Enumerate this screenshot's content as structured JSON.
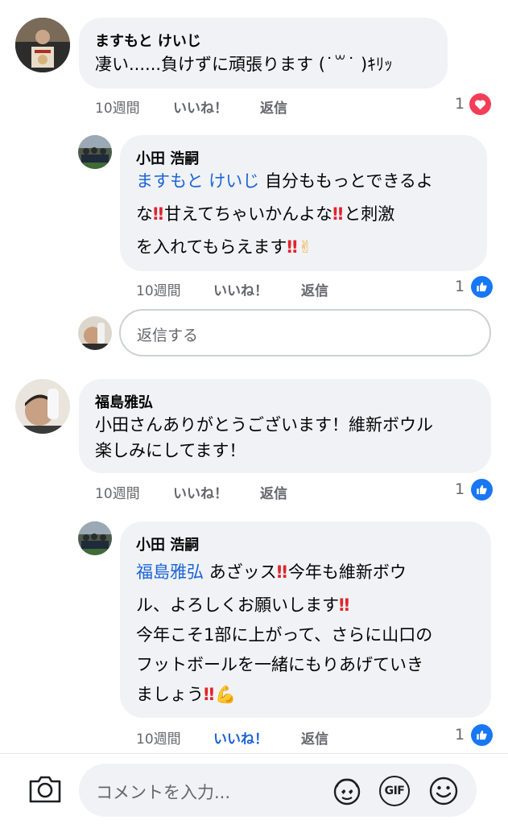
{
  "comments": [
    {
      "author": "ますもと けいじ",
      "lines": [
        "凄い......負けずに頑張ります (˙꒳˙ )ｷﾘｯ"
      ],
      "time": "10週間",
      "like": "いいね！",
      "reply": "返信",
      "reaction_count": "1",
      "reaction_icon": "heart-icon"
    },
    {
      "author": "小田 浩嗣",
      "mention": "ますもと けいじ",
      "line1_text": "自分ももっとできるよ",
      "line2_a": "な",
      "line2_b": "甘えてちゃいかんよな",
      "line2_c": "と刺激",
      "line3": "を入れてもらえます",
      "time": "10週間",
      "like": "いいね！",
      "reply": "返信",
      "reaction_count": "1",
      "reaction_icon": "thumbs-up-icon",
      "emoji_bang": "‼",
      "emoji_v": "✌"
    },
    {
      "author": "福島雅弘",
      "lines": [
        "小田さんありがとうございます！維新ボウル",
        "楽しみにしてます！"
      ],
      "time": "10週間",
      "like": "いいね！",
      "reply": "返信",
      "reaction_count": "1",
      "reaction_icon": "thumbs-up-icon"
    },
    {
      "author": "小田 浩嗣",
      "mention": "福島雅弘",
      "line1_a": "あざッス",
      "line1_b": "今年も維新ボウ",
      "line2": "ル、よろしくお願いします",
      "line3": "今年こそ1部に上がって、さらに山口の",
      "line4": "フットボールを一緒にもりあげていき",
      "line5": "ましょう",
      "time": "10週間",
      "like": "いいね！",
      "reply": "返信",
      "reaction_count": "1",
      "reaction_icon": "thumbs-up-icon",
      "emoji_bang": "‼",
      "emoji_muscle": "💪"
    }
  ],
  "reply_input": {
    "placeholder": "返信する"
  },
  "footer": {
    "placeholder": "コメントを入力...",
    "camera_icon": "camera-icon",
    "sticker_icon": "sticker-icon",
    "gif_label": "GIF",
    "emoji_icon": "smiley-icon"
  },
  "colors": {
    "mention": "#1b64d6",
    "like": "#1877f2",
    "love": "#f33e58",
    "bubble": "#f0f2f5"
  }
}
